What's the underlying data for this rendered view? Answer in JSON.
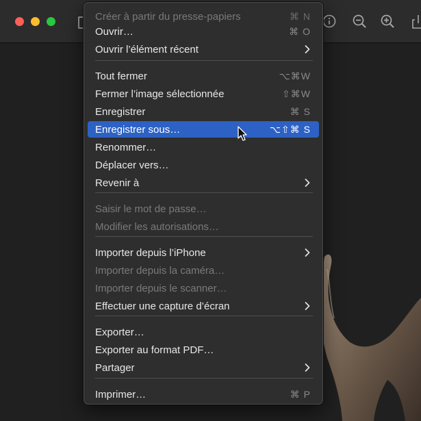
{
  "window": {
    "traffic_lights": {
      "red": "#fe5f57",
      "yellow": "#febc2e",
      "green": "#28c840"
    },
    "toolbar_icons": [
      "info-icon",
      "zoom-out-icon",
      "zoom-in-icon",
      "share-icon"
    ]
  },
  "menu": {
    "highlight_color": "#2d62c4",
    "items": [
      {
        "label": "Créer à partir du presse-papiers",
        "shortcut": "⌘ N",
        "disabled": true
      },
      {
        "label": "Ouvrir…",
        "shortcut": "⌘ O"
      },
      {
        "label": "Ouvrir l’élément récent",
        "submenu": true
      },
      {
        "label": "Tout fermer",
        "shortcut": "⌥⌘W"
      },
      {
        "label": "Fermer l’image sélectionnée",
        "shortcut": "⇧⌘W"
      },
      {
        "label": "Enregistrer",
        "shortcut": "⌘ S"
      },
      {
        "label": "Enregistrer sous…",
        "shortcut": "⌥⇧⌘ S",
        "highlighted": true
      },
      {
        "label": "Renommer…"
      },
      {
        "label": "Déplacer vers…"
      },
      {
        "label": "Revenir à",
        "submenu": true
      },
      {
        "label": "Saisir le mot de passe…",
        "disabled": true
      },
      {
        "label": "Modifier les autorisations…",
        "disabled": true
      },
      {
        "label": "Importer depuis l’iPhone",
        "submenu": true
      },
      {
        "label": "Importer depuis la caméra…",
        "disabled": true
      },
      {
        "label": "Importer depuis le scanner…",
        "disabled": true
      },
      {
        "label": "Effectuer une capture d’écran",
        "submenu": true
      },
      {
        "label": "Exporter…"
      },
      {
        "label": "Exporter au format PDF…"
      },
      {
        "label": "Partager",
        "submenu": true
      },
      {
        "label": "Imprimer…",
        "shortcut": "⌘ P"
      }
    ]
  }
}
